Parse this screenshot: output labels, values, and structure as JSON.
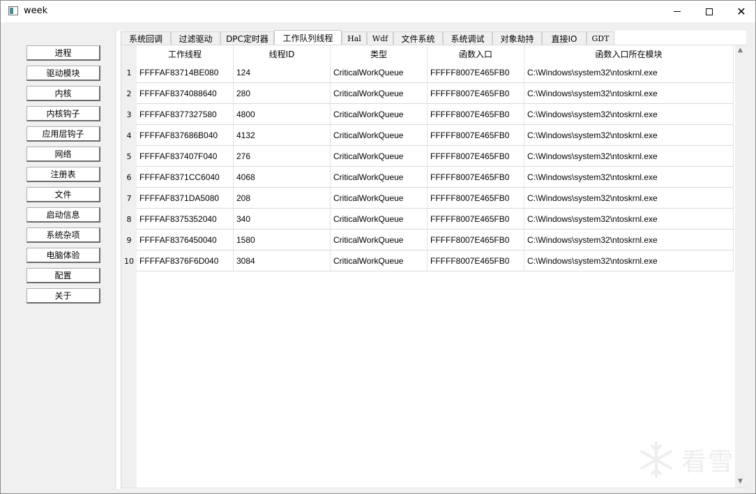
{
  "window": {
    "title": "week"
  },
  "sidebar": {
    "items": [
      {
        "label": "进程"
      },
      {
        "label": "驱动模块"
      },
      {
        "label": "内核"
      },
      {
        "label": "内核钩子"
      },
      {
        "label": "应用层钩子"
      },
      {
        "label": "网络"
      },
      {
        "label": "注册表"
      },
      {
        "label": "文件"
      },
      {
        "label": "启动信息"
      },
      {
        "label": "系统杂项"
      },
      {
        "label": "电脑体验"
      },
      {
        "label": "配置"
      },
      {
        "label": "关于"
      }
    ]
  },
  "tabs": [
    {
      "label": "系统回调"
    },
    {
      "label": "过滤驱动"
    },
    {
      "label": "DPC定时器"
    },
    {
      "label": "工作队列线程",
      "active": true
    },
    {
      "label": "Hal"
    },
    {
      "label": "Wdf"
    },
    {
      "label": "文件系统"
    },
    {
      "label": "系统调试"
    },
    {
      "label": "对象劫持"
    },
    {
      "label": "直接IO"
    },
    {
      "label": "GDT"
    }
  ],
  "table": {
    "columns": [
      "工作线程",
      "线程ID",
      "类型",
      "函数入口",
      "函数入口所在模块"
    ],
    "rows": [
      {
        "n": "1",
        "cells": [
          "FFFFAF83714BE080",
          "124",
          "CriticalWorkQueue",
          "FFFFF8007E465FB0",
          "C:\\Windows\\system32\\ntoskrnl.exe"
        ]
      },
      {
        "n": "2",
        "cells": [
          "FFFFAF8374088640",
          "280",
          "CriticalWorkQueue",
          "FFFFF8007E465FB0",
          "C:\\Windows\\system32\\ntoskrnl.exe"
        ]
      },
      {
        "n": "3",
        "cells": [
          "FFFFAF8377327580",
          "4800",
          "CriticalWorkQueue",
          "FFFFF8007E465FB0",
          "C:\\Windows\\system32\\ntoskrnl.exe"
        ]
      },
      {
        "n": "4",
        "cells": [
          "FFFFAF837686B040",
          "4132",
          "CriticalWorkQueue",
          "FFFFF8007E465FB0",
          "C:\\Windows\\system32\\ntoskrnl.exe"
        ]
      },
      {
        "n": "5",
        "cells": [
          "FFFFAF837407F040",
          "276",
          "CriticalWorkQueue",
          "FFFFF8007E465FB0",
          "C:\\Windows\\system32\\ntoskrnl.exe"
        ]
      },
      {
        "n": "6",
        "cells": [
          "FFFFAF8371CC6040",
          "4068",
          "CriticalWorkQueue",
          "FFFFF8007E465FB0",
          "C:\\Windows\\system32\\ntoskrnl.exe"
        ]
      },
      {
        "n": "7",
        "cells": [
          "FFFFAF8371DA5080",
          "208",
          "CriticalWorkQueue",
          "FFFFF8007E465FB0",
          "C:\\Windows\\system32\\ntoskrnl.exe"
        ]
      },
      {
        "n": "8",
        "cells": [
          "FFFFAF8375352040",
          "340",
          "CriticalWorkQueue",
          "FFFFF8007E465FB0",
          "C:\\Windows\\system32\\ntoskrnl.exe"
        ]
      },
      {
        "n": "9",
        "cells": [
          "FFFFAF8376450040",
          "1580",
          "CriticalWorkQueue",
          "FFFFF8007E465FB0",
          "C:\\Windows\\system32\\ntoskrnl.exe"
        ]
      },
      {
        "n": "10",
        "cells": [
          "FFFFAF8376F6D040",
          "3084",
          "CriticalWorkQueue",
          "FFFFF8007E465FB0",
          "C:\\Windows\\system32\\ntoskrnl.exe"
        ]
      }
    ]
  },
  "watermark": {
    "text": "看雪"
  },
  "icons": {
    "minimize": "minimize-icon",
    "maximize": "maximize-icon",
    "close": "close-icon",
    "scroll_up": "chevron-up-icon",
    "scroll_down": "chevron-down-icon"
  }
}
